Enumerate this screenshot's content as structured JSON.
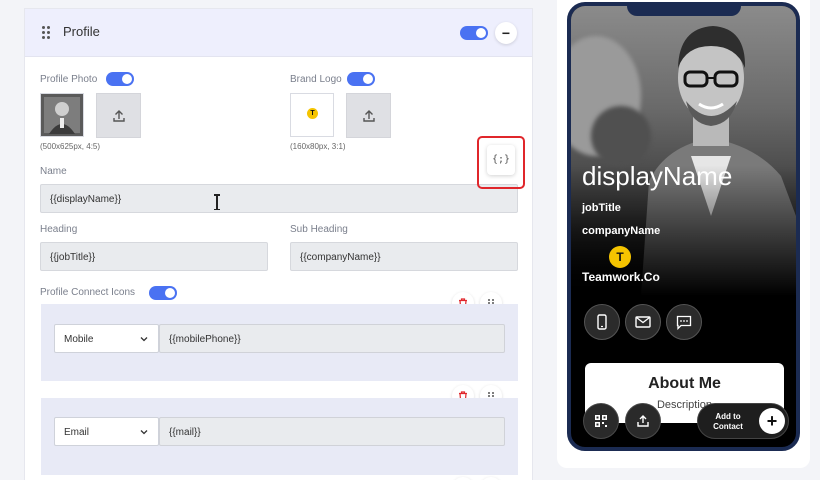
{
  "profile": {
    "title": "Profile",
    "enabled": true
  },
  "photo": {
    "label": "Profile Photo",
    "hint": "(500x625px, 4:5)",
    "enabled": true
  },
  "logo": {
    "label": "Brand Logo",
    "hint": "(160x80px, 3:1)",
    "logo_letter": "T",
    "logo_color": "#f5c400",
    "enabled": true
  },
  "variable_button": {
    "label": "{;}"
  },
  "fields": {
    "name_label": "Name",
    "name_value": "{{displayName}}",
    "heading_label": "Heading",
    "heading_value": "{{jobTitle}}",
    "subheading_label": "Sub Heading",
    "subheading_value": "{{companyName}}"
  },
  "connect": {
    "label": "Profile Connect Icons",
    "enabled": true,
    "items": [
      {
        "type": "Mobile",
        "value": "{{mobilePhone}}"
      },
      {
        "type": "Email",
        "value": "{{mail}}"
      }
    ]
  },
  "preview": {
    "display_name": "displayName",
    "job_title": "jobTitle",
    "company_name": "companyName",
    "company_logo_letter": "T",
    "company_label": "Teamwork.Co",
    "about_title": "About Me",
    "about_description": "Description",
    "add_contact_label": "Add to Contact",
    "plus": "+"
  },
  "colors": {
    "accent": "#4a72f2",
    "highlight_border": "#e0262b",
    "phone_frame": "#1b2b52"
  }
}
